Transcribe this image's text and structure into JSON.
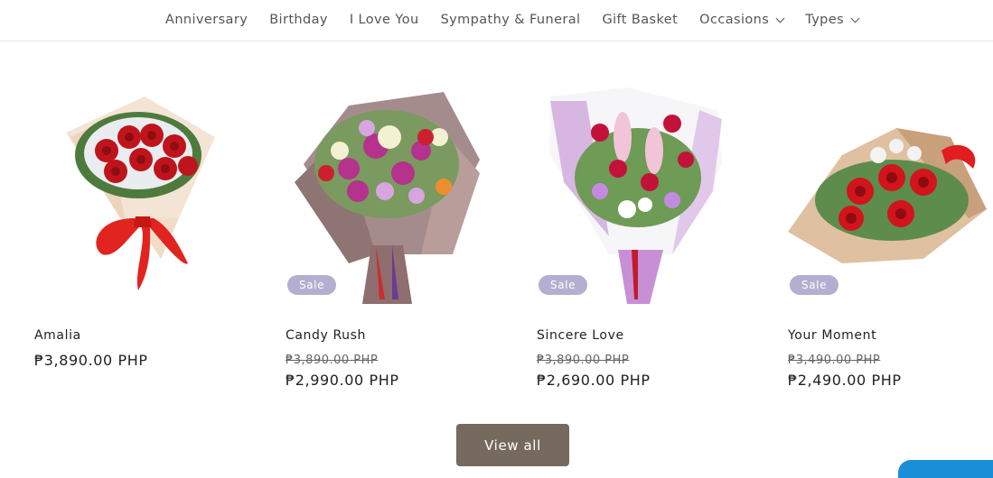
{
  "nav": {
    "items": [
      {
        "label": "Anniversary"
      },
      {
        "label": "Birthday"
      },
      {
        "label": "I Love You"
      },
      {
        "label": "Sympathy & Funeral"
      },
      {
        "label": "Gift Basket"
      },
      {
        "label": "Occasions",
        "has_dropdown": true
      },
      {
        "label": "Types",
        "has_dropdown": true
      }
    ]
  },
  "products": [
    {
      "name": "Amalia",
      "price": "₱3,890.00 PHP"
    },
    {
      "name": "Candy Rush",
      "badge": "Sale",
      "compare_price": "₱3,890.00 PHP",
      "price": "₱2,990.00 PHP"
    },
    {
      "name": "Sincere Love",
      "badge": "Sale",
      "compare_price": "₱3,890.00 PHP",
      "price": "₱2,690.00 PHP"
    },
    {
      "name": "Your Moment",
      "badge": "Sale",
      "compare_price": "₱3,490.00 PHP",
      "price": "₱2,490.00 PHP"
    }
  ],
  "view_all_label": "View all",
  "colors": {
    "sale_badge": "#b4afd0",
    "button": "#76695e",
    "chat_widget": "#1a8fd8"
  }
}
